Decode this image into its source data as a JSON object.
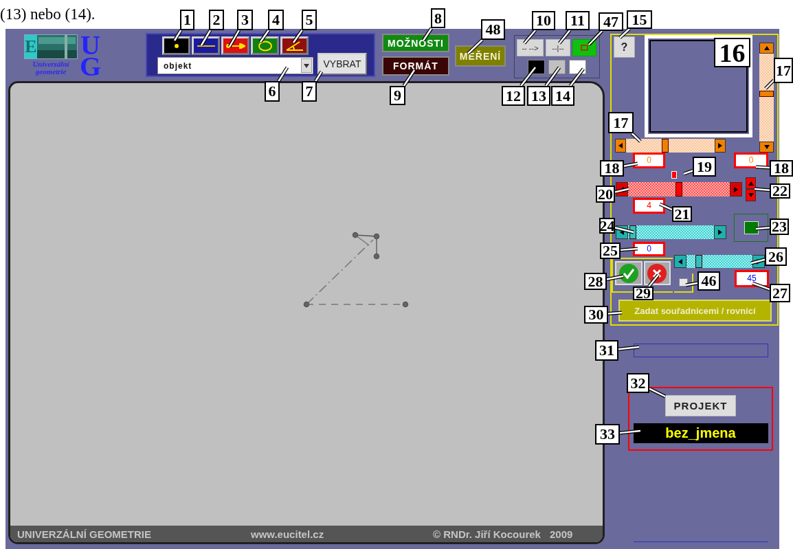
{
  "document_text": "(13) nebo (14).",
  "logo": {
    "letters": [
      "E",
      "U",
      "G"
    ],
    "caption": "Univerzální geometrie"
  },
  "object_select": {
    "value": "objekt"
  },
  "buttons": {
    "select": "VYBRAT",
    "options": "MOŽNOSTI",
    "format": "FORMÁT",
    "measure": "MĚŘENÍ",
    "help": "?",
    "coordinates": "Zadat souřadnicemi / rovnicí",
    "project": "PROJEKT"
  },
  "line_styles": [
    "-- -->",
    "--|--"
  ],
  "colors": [
    {
      "color": "#000000"
    },
    {
      "color": "#c0c0c0"
    },
    {
      "color": "#ffffff"
    }
  ],
  "preview_fields": [
    "0",
    "0"
  ],
  "size_slider": {
    "level": 0.5
  },
  "size_value": "4",
  "rotation_slider": {
    "level": 0.02
  },
  "rotation_value": "0",
  "angle_slider": {
    "level": 0.15
  },
  "angle_value": "45",
  "checkbox": {
    "checked": false
  },
  "project_name": "bez_jmena",
  "footer": [
    "UNIVERZÁLNÍ GEOMETRIE",
    "www.eucitel.cz",
    "©  RNDr. Jiří Kocourek",
    "2009"
  ],
  "callouts": [
    "1",
    "2",
    "3",
    "4",
    "5",
    "8",
    "48",
    "10",
    "11",
    "47",
    "15",
    "16",
    "17",
    "6",
    "7",
    "9",
    "12",
    "13",
    "14",
    "17",
    "18",
    "19",
    "18",
    "20",
    "22",
    "21",
    "24",
    "23",
    "25",
    "26",
    "28",
    "29",
    "46",
    "27",
    "30",
    "31",
    "32",
    "33"
  ]
}
